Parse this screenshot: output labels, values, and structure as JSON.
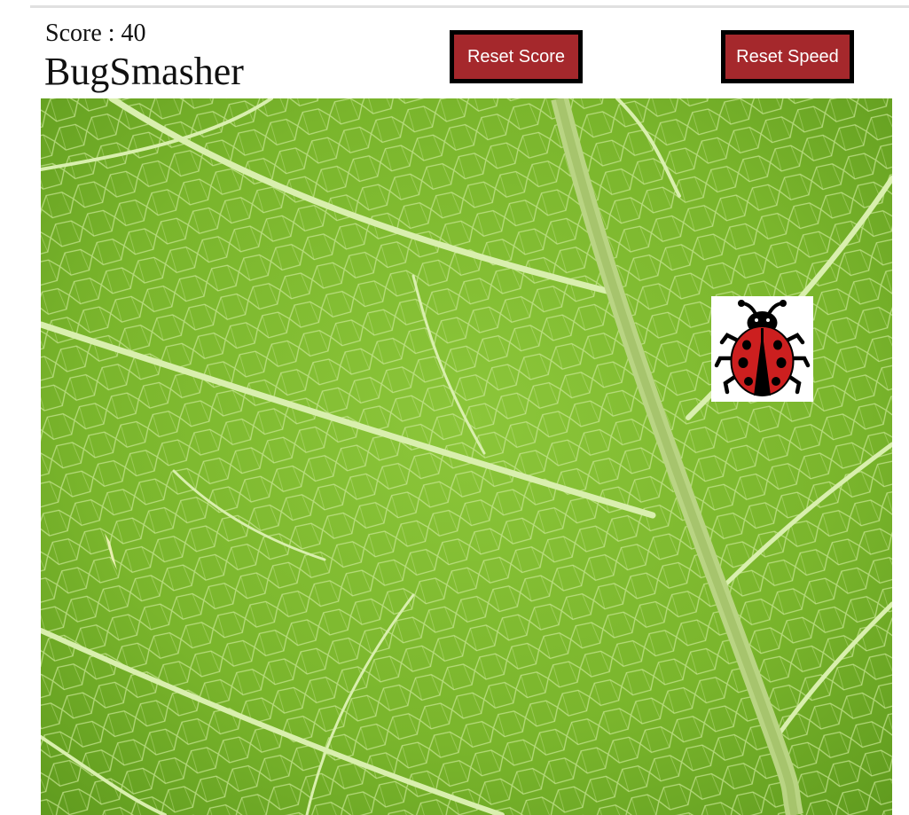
{
  "header": {
    "score_text": "Score : 40",
    "title": "BugSmasher"
  },
  "buttons": {
    "reset_score_label": "Reset Score",
    "reset_speed_label": "Reset Speed",
    "button_color": "#a5282c",
    "button_border_color": "#000000"
  },
  "game": {
    "background": "green leaf with vein texture",
    "leaf_color": "#7cb52a",
    "vein_color": "#d7eeaa",
    "bug": {
      "icon": "ladybug-icon",
      "body_color": "#cc1f1f",
      "spot_color": "#000000"
    }
  }
}
